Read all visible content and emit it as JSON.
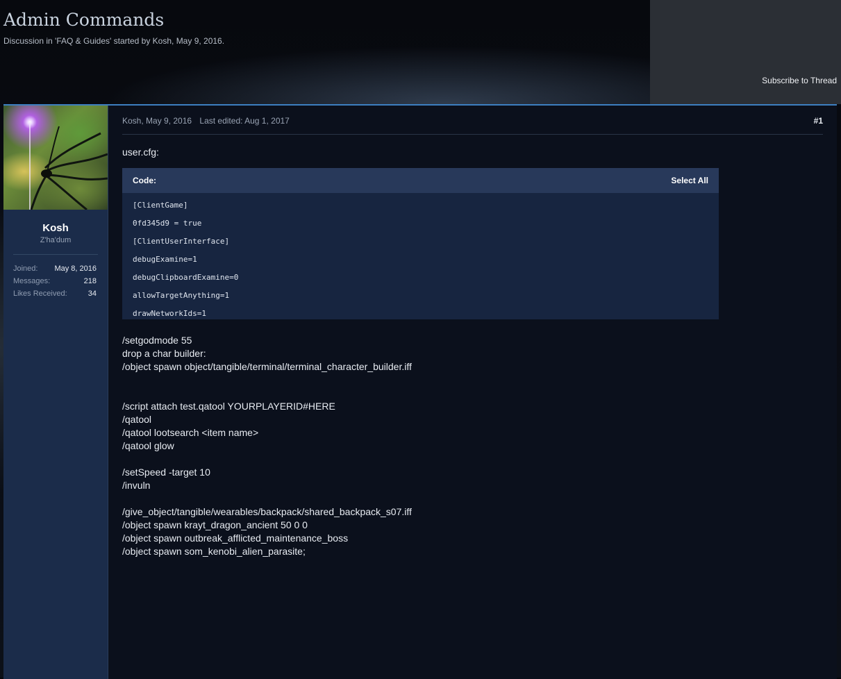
{
  "thread": {
    "title": "Admin Commands",
    "subtitle": "Discussion in 'FAQ & Guides' started by Kosh, May 9, 2016.",
    "subscribe_label": "Subscribe to Thread"
  },
  "user": {
    "name": "Kosh",
    "title": "Z'ha'dum",
    "stats": [
      {
        "label": "Joined:",
        "value": "May 8, 2016"
      },
      {
        "label": "Messages:",
        "value": "218"
      },
      {
        "label": "Likes Received:",
        "value": "34"
      }
    ]
  },
  "post": {
    "author_date": "Kosh, May 9, 2016",
    "last_edited": "Last edited: Aug 1, 2017",
    "number": "#1",
    "intro": "user.cfg:",
    "code": {
      "header_label": "Code:",
      "select_all_label": "Select All",
      "lines": [
        "[ClientGame]",
        "0fd345d9 = true",
        "[ClientUserInterface]",
        "debugExamine=1",
        "debugClipboardExamine=0",
        "allowTargetAnything=1",
        "drawNetworkIds=1"
      ]
    },
    "commands": [
      "/setgodmode 55",
      "drop a char builder:",
      "/object spawn object/tangible/terminal/terminal_character_builder.iff",
      "",
      "",
      "/script attach test.qatool YOURPLAYERID#HERE",
      "/qatool",
      "/qatool lootsearch <item name>",
      "/qatool glow",
      "",
      "/setSpeed -target 10",
      "/invuln",
      "",
      "/give_object/tangible/wearables/backpack/shared_backpack_s07.iff",
      "/object spawn krayt_dragon_ancient 50 0 0",
      "/object spawn outbreak_afflicted_maintenance_boss",
      "/object spawn som_kenobi_alien_parasite;"
    ]
  },
  "colors": {
    "accent": "#3d7fc1",
    "user_panel": "#1b2c4a",
    "code_header": "#28395a",
    "code_body": "#172540",
    "post_bg": "#0b101c"
  }
}
